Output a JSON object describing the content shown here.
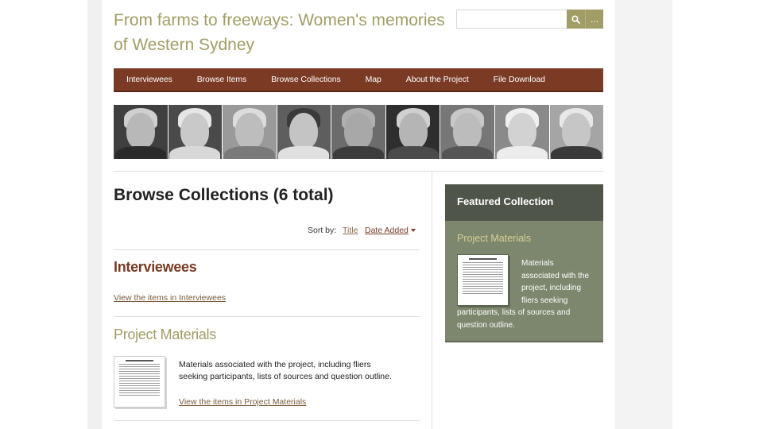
{
  "site": {
    "title": "From farms to freeways: Women's memories of Western Sydney"
  },
  "search": {
    "placeholder": "",
    "advanced_label": "..."
  },
  "nav": {
    "items": [
      {
        "label": "Interviewees"
      },
      {
        "label": "Browse Items"
      },
      {
        "label": "Browse Collections"
      },
      {
        "label": "Map"
      },
      {
        "label": "About the Project"
      },
      {
        "label": "File Download"
      }
    ]
  },
  "colors": {
    "accent": "#a19d66",
    "nav_bg": "#7a3a24",
    "featured_head": "#50554a",
    "featured_body": "#7d876d"
  },
  "main": {
    "page_title": "Browse Collections (6 total)",
    "sort": {
      "label": "Sort by:",
      "options": [
        {
          "label": "Title"
        },
        {
          "label": "Date Added"
        }
      ]
    },
    "collections": [
      {
        "title": "Interviewees",
        "link": "View the items in Interviewees"
      },
      {
        "title": "Project Materials",
        "description": "Materials associated with the project, including fliers seeking participants, lists of sources and question outline.",
        "link": "View the items in Project Materials"
      }
    ]
  },
  "featured": {
    "heading": "Featured Collection",
    "title": "Project Materials",
    "description": "Materials associated with the project, including fliers seeking participants, lists of sources and question outline."
  }
}
